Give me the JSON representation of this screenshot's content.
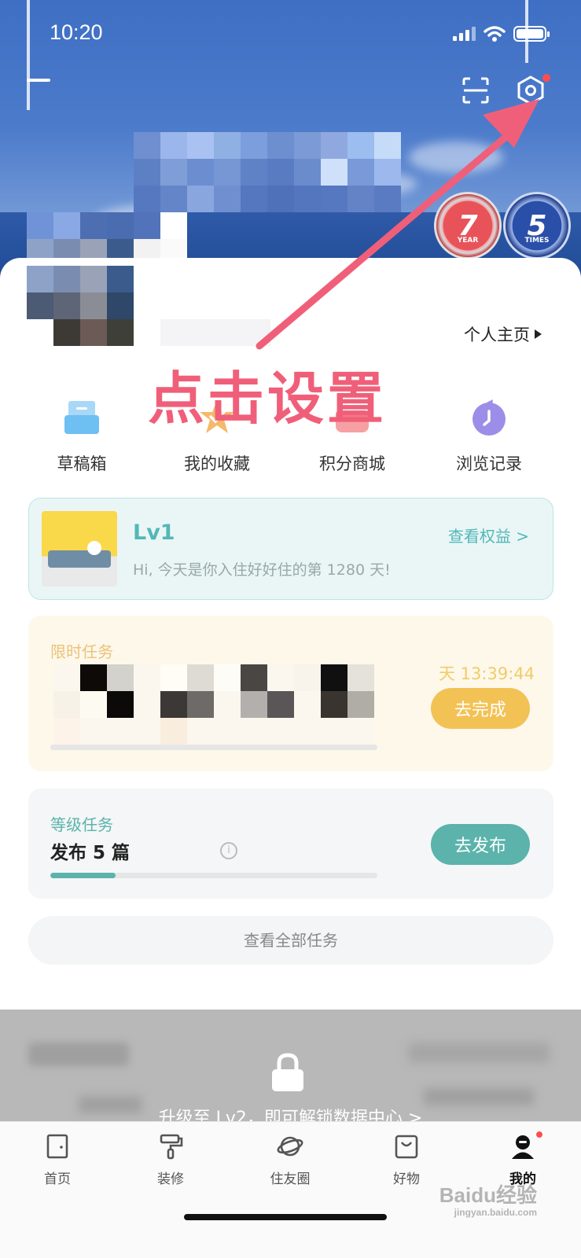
{
  "status_bar": {
    "time": "10:20"
  },
  "header": {
    "profile_link": "个人主页",
    "badges": [
      {
        "number": "7",
        "caption": "YEAR",
        "color": "#e8535a"
      },
      {
        "number": "5",
        "caption": "TIMES",
        "color": "#2a4fa8"
      }
    ],
    "settings_dot_color": "#ff4d4f"
  },
  "annotation": {
    "text": "点击设置",
    "color": "#f05f79"
  },
  "quick_actions": [
    {
      "label": "草稿箱",
      "icon": "drafts-icon"
    },
    {
      "label": "我的收藏",
      "icon": "star-icon"
    },
    {
      "label": "积分商城",
      "icon": "mall-icon"
    },
    {
      "label": "浏览记录",
      "icon": "history-icon"
    }
  ],
  "level": {
    "name": "Lv1",
    "link": "查看权益 >",
    "message": "Hi, 今天是你入住好好住的第 1280 天!"
  },
  "limited_task": {
    "title": "限时任务",
    "countdown": "天 13:39:44",
    "button": "去完成",
    "progress": 0
  },
  "grade_task": {
    "title": "等级任务",
    "subtitle": "发布 5 篇",
    "button": "去发布",
    "progress": 0.2
  },
  "all_tasks_label": "查看全部任务",
  "locked": {
    "message": "升级至 Lv2，即可解锁数据中心 >"
  },
  "tabbar": [
    {
      "label": "首页",
      "icon": "home-icon"
    },
    {
      "label": "装修",
      "icon": "paint-roller-icon"
    },
    {
      "label": "住友圈",
      "icon": "planet-icon"
    },
    {
      "label": "好物",
      "icon": "shopping-bag-icon"
    },
    {
      "label": "我的",
      "icon": "profile-icon",
      "active": true
    }
  ],
  "watermark": {
    "brand": "Baidu经验",
    "sub": "jingyan.baidu.com"
  },
  "colors": {
    "accent": "#5bb3ab",
    "warning": "#f2c255",
    "pink": "#f05f79"
  }
}
